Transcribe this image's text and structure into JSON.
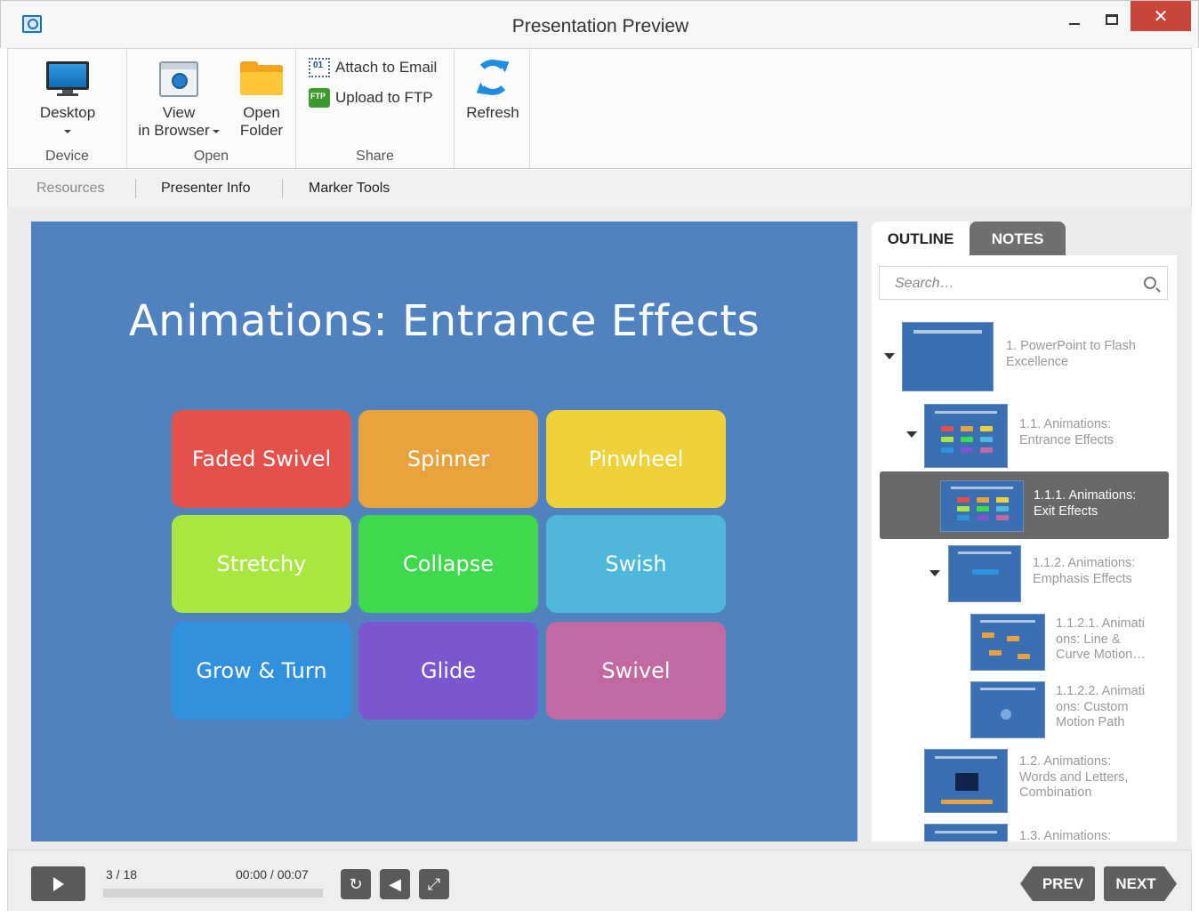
{
  "window": {
    "title": "Presentation Preview",
    "minimize_glyph": "",
    "close_glyph": "✕"
  },
  "ribbon": {
    "device": {
      "group_label": "Device",
      "desktop_label": "Desktop"
    },
    "open": {
      "group_label": "Open",
      "view_label_1": "View",
      "view_label_2": "in Browser",
      "folder_label_1": "Open",
      "folder_label_2": "Folder"
    },
    "share": {
      "group_label": "Share",
      "email_label": "Attach to Email",
      "ftp_label": "Upload to FTP"
    },
    "refresh_label": "Refresh"
  },
  "subtabs": {
    "resources": "Resources",
    "presenter_info": "Presenter Info",
    "marker_tools": "Marker Tools"
  },
  "slide": {
    "title": "Animations: Entrance Effects",
    "tiles": [
      {
        "label": "Faded Swivel",
        "color": "#e4514a"
      },
      {
        "label": "Spinner",
        "color": "#e9a33e"
      },
      {
        "label": "Pinwheel",
        "color": "#efd13a"
      },
      {
        "label": "Stretchy",
        "color": "#a9e640"
      },
      {
        "label": "Collapse",
        "color": "#3ed94d"
      },
      {
        "label": "Swish",
        "color": "#4fb7d9"
      },
      {
        "label": "Grow & Turn",
        "color": "#3291df"
      },
      {
        "label": "Glide",
        "color": "#7a56cf"
      },
      {
        "label": "Swivel",
        "color": "#c06aa1"
      }
    ]
  },
  "panel": {
    "tab_outline": "OUTLINE",
    "tab_notes": "NOTES",
    "search_placeholder": "Search…",
    "outline": [
      {
        "line1": "1. PowerPoint to Flash",
        "line2": "Excellence",
        "line3": ""
      },
      {
        "line1": "1.1. Animations:",
        "line2": "Entrance Effects",
        "line3": ""
      },
      {
        "line1": "1.1.1. Animations:",
        "line2": "Exit Effects",
        "line3": ""
      },
      {
        "line1": "1.1.2. Animations:",
        "line2": "Emphasis Effects",
        "line3": ""
      },
      {
        "line1": "1.1.2.1. Animati",
        "line2": "ons: Line &",
        "line3": "Curve Motion…"
      },
      {
        "line1": "1.1.2.2. Animati",
        "line2": "ons: Custom",
        "line3": "Motion Path"
      },
      {
        "line1": "1.2. Animations:",
        "line2": "Words and Letters,",
        "line3": "Combination"
      },
      {
        "line1": "1.3. Animations:",
        "line2": "",
        "line3": ""
      }
    ]
  },
  "player": {
    "counter": "3 / 18",
    "time": "00:00 / 00:07",
    "progress_fraction": 0,
    "prev_label": "PREV",
    "next_label": "NEXT"
  },
  "colors": {
    "slide_bg": "#5082c0",
    "active_item": "#696969",
    "close_button": "#c7453a"
  }
}
